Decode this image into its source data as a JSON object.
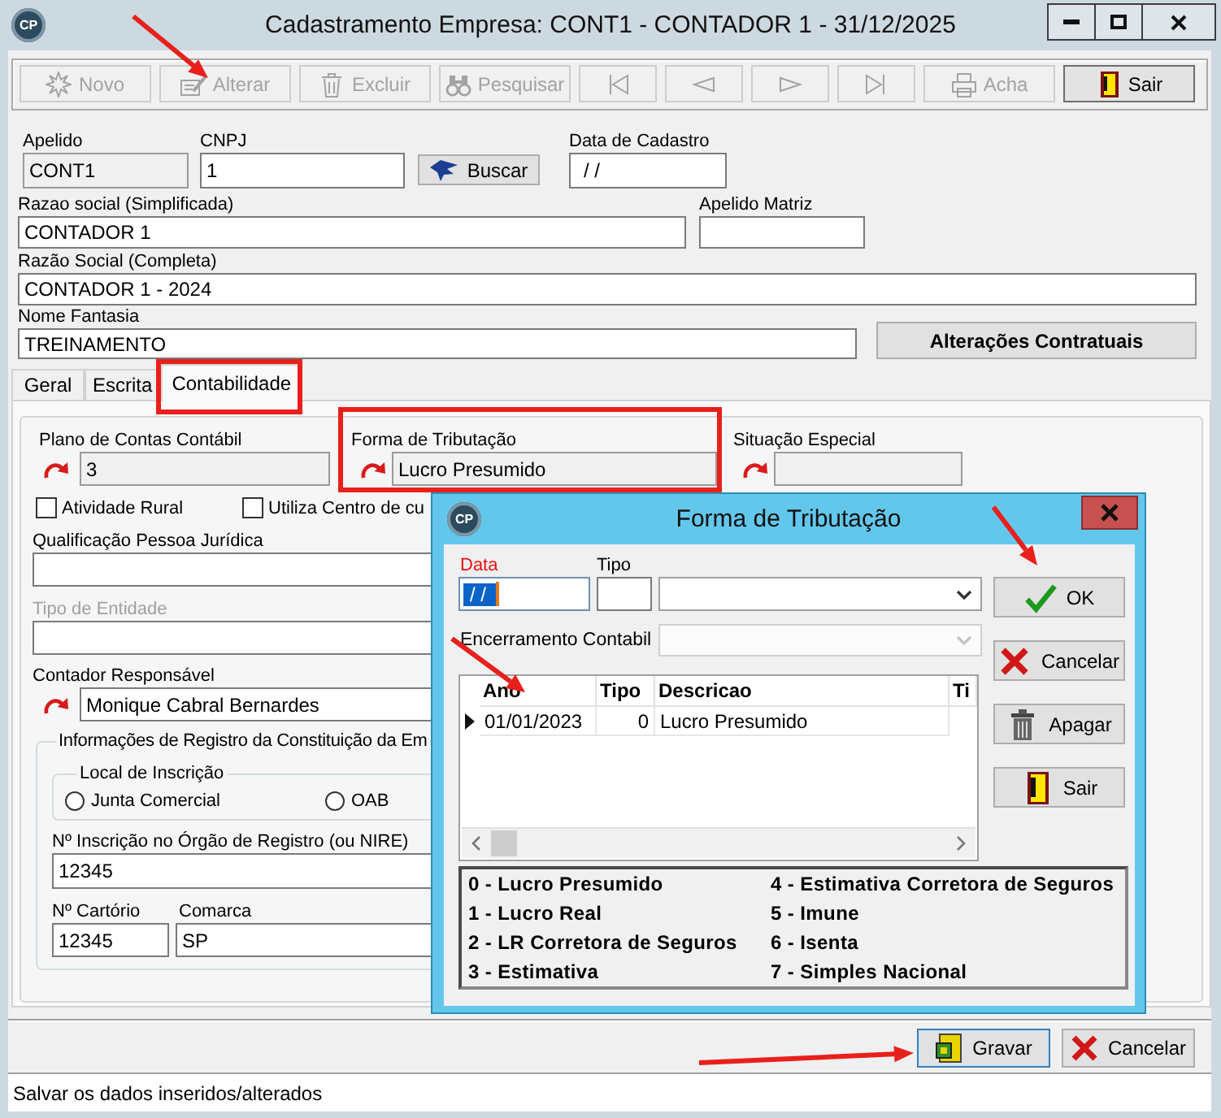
{
  "window": {
    "logo": "CP",
    "title": "Cadastramento Empresa: CONT1 - CONTADOR 1 - 31/12/2025"
  },
  "toolbar": [
    {
      "kind": "new",
      "label": "Novo",
      "disabled": true
    },
    {
      "kind": "edit",
      "label": "Alterar",
      "disabled": true
    },
    {
      "kind": "delete",
      "label": "Excluir",
      "disabled": true
    },
    {
      "kind": "search",
      "label": "Pesquisar",
      "disabled": true
    },
    {
      "kind": "first",
      "disabled": true
    },
    {
      "kind": "previous",
      "disabled": true
    },
    {
      "kind": "next",
      "disabled": true
    },
    {
      "kind": "last",
      "disabled": true
    },
    {
      "kind": "find",
      "label": "Acha",
      "disabled": true
    },
    {
      "kind": "exit",
      "label": "Sair",
      "disabled": false
    }
  ],
  "company": {
    "nickname": {
      "label": "Apelido",
      "value": "CONT1",
      "readonly": true
    },
    "cnpj": {
      "label": "CNPJ",
      "value": "1",
      "readonly": false
    },
    "lookup_button": {
      "label": "Buscar"
    },
    "registration_date": {
      "label": "Data de Cadastro",
      "value": "/ /",
      "readonly": false
    },
    "short_name": {
      "label": "Razao social (Simplificada)",
      "value": "CONTADOR 1",
      "readonly": false
    },
    "parent_nickname": {
      "label": "Apelido Matriz",
      "readonly": false
    },
    "full_name": {
      "label": "Razão Social (Completa)",
      "value": "CONTADOR 1 - 2024",
      "readonly": false
    },
    "trade_name": {
      "label": "Nome Fantasia",
      "value": "TREINAMENTO",
      "readonly": false
    },
    "contract_button": {
      "label": "Alterações Contratuais"
    }
  },
  "tabs": [
    {
      "label": "Geral",
      "selected": false
    },
    {
      "label": "Escrita",
      "selected": false
    },
    {
      "label": "Contabilidade",
      "selected": true
    }
  ],
  "accounting": {
    "chart_of_accounts": {
      "label": "Plano de Contas Contábil",
      "value": "3",
      "readonly": true
    },
    "taxation": {
      "label": "Forma de Tributação",
      "value": "Lucro Presumido",
      "readonly": true
    },
    "special_situation": {
      "label": "Situação Especial",
      "readonly": true
    },
    "checkboxes": [
      {
        "label": "Atividade Rural",
        "checked": false
      },
      {
        "label": "Utiliza Centro de cu",
        "checked": false
      }
    ],
    "legal_qualification": {
      "label": "Qualificação Pessoa Jurídica",
      "readonly": false
    },
    "entity_type": {
      "label": "Tipo de Entidade",
      "disabled": true
    },
    "accountant": {
      "label": "Contador Responsável",
      "value": "Monique Cabral Bernardes",
      "readonly": false
    },
    "registration": {
      "title": "Informações de Registro da Constituição da Em",
      "place": {
        "title": "Local de Inscrição",
        "options": [
          {
            "label": "Junta Comercial",
            "selected": false
          },
          {
            "label": "OAB",
            "selected": false
          }
        ]
      },
      "nire": {
        "label": "Nº Inscrição no Órgão de Registro (ou NIRE)",
        "value": "12345"
      },
      "notary": {
        "label": "Nº Cartório",
        "value": "12345"
      },
      "district": {
        "label": "Comarca",
        "value": "SP"
      }
    }
  },
  "footer_buttons": [
    {
      "kind": "save",
      "label": "Gravar",
      "focused": true
    },
    {
      "kind": "cancel",
      "label": "Cancelar",
      "focused": false
    }
  ],
  "status_bar": {
    "text": "Salvar os dados inseridos/alterados"
  },
  "dialog": {
    "logo": "CP",
    "title": "Forma de Tributação",
    "date": {
      "label": "Data",
      "value": "/ /",
      "required": true,
      "focused": true
    },
    "type": {
      "label": "Tipo"
    },
    "closing": {
      "label": "Encerramento Contabil",
      "disabled": true
    },
    "grid": {
      "columns": [
        "Ano",
        "Tipo",
        "Descricao",
        "Ti"
      ],
      "rows": [
        {
          "current": true,
          "cells": [
            "01/01/2023",
            "0",
            "Lucro Presumido"
          ]
        }
      ]
    },
    "buttons": [
      {
        "kind": "ok",
        "label": "OK"
      },
      {
        "kind": "cancel",
        "label": "Cancelar"
      },
      {
        "kind": "delete",
        "label": "Apagar"
      },
      {
        "kind": "exit",
        "label": "Sair"
      }
    ],
    "legend": [
      "0 - Lucro Presumido",
      "1 - Lucro Real",
      "2 - LR Corretora de Seguros",
      "3 - Estimativa",
      "4 - Estimativa Corretora de Seguros",
      "5 - Imune",
      "6 - Isenta",
      "7 - Simples Nacional"
    ]
  }
}
